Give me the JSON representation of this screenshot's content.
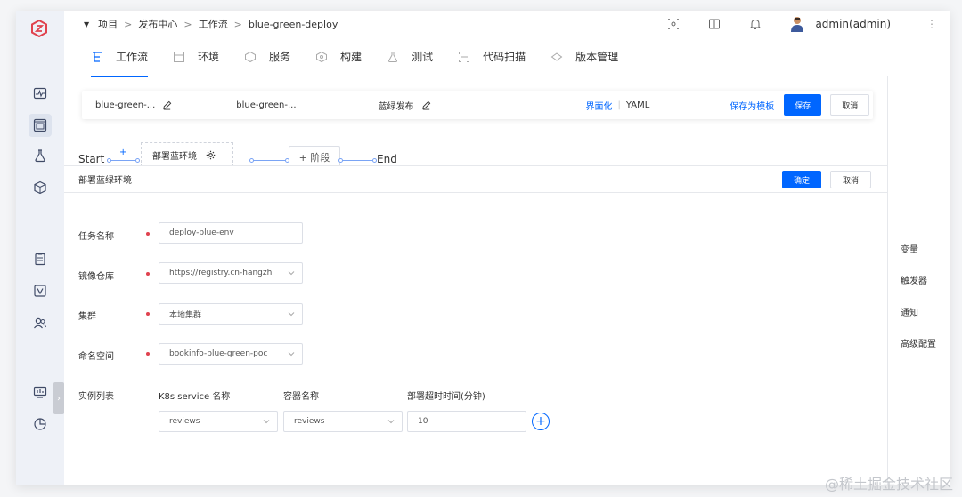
{
  "breadcrumb": {
    "items": [
      "项目",
      "发布中心",
      "工作流",
      "blue-green-deploy"
    ],
    "separator": ">"
  },
  "header": {
    "user": "admin(admin)"
  },
  "tabs": [
    {
      "label": "工作流",
      "icon": "workflow-icon",
      "active": true
    },
    {
      "label": "环境",
      "icon": "environment-icon"
    },
    {
      "label": "服务",
      "icon": "service-icon"
    },
    {
      "label": "构建",
      "icon": "build-icon"
    },
    {
      "label": "测试",
      "icon": "test-icon"
    },
    {
      "label": "代码扫描",
      "icon": "code-scan-icon"
    },
    {
      "label": "版本管理",
      "icon": "version-icon"
    }
  ],
  "toolbar": {
    "name_field": "blue-green-...",
    "name_field_2": "blue-green-...",
    "release_type": "蓝绿发布",
    "view_visual": "界面化",
    "view_yaml": "YAML",
    "save_template": "保存为模板",
    "save": "保存",
    "cancel": "取消"
  },
  "side_panel": {
    "items": [
      "变量",
      "触发器",
      "通知",
      "高级配置"
    ]
  },
  "pipeline": {
    "start": "Start",
    "stage": "部署蓝环境",
    "add_stage": "+ 阶段",
    "end": "End",
    "plus": "+"
  },
  "dialog": {
    "title": "部署蓝绿环境",
    "confirm": "确定",
    "cancel": "取消",
    "fields": {
      "task_name": {
        "label": "任务名称",
        "value": "deploy-blue-env"
      },
      "registry": {
        "label": "镜像仓库",
        "value": "https://registry.cn-hangzh"
      },
      "cluster": {
        "label": "集群",
        "value": "本地集群"
      },
      "namespace": {
        "label": "命名空间",
        "value": "bookinfo-blue-green-poc"
      }
    },
    "instances": {
      "label": "实例列表",
      "col_service": "K8s service 名称",
      "col_container": "容器名称",
      "col_timeout": "部署超时时间(分钟)",
      "service_value": "reviews",
      "container_value": "reviews",
      "timeout_value": "10"
    }
  },
  "watermark": "@稀土掘金技术社区",
  "colors": {
    "primary": "#0066ff",
    "required": "#e0424e",
    "rail_bg": "#eef1f7",
    "logo": "#e0424e"
  }
}
